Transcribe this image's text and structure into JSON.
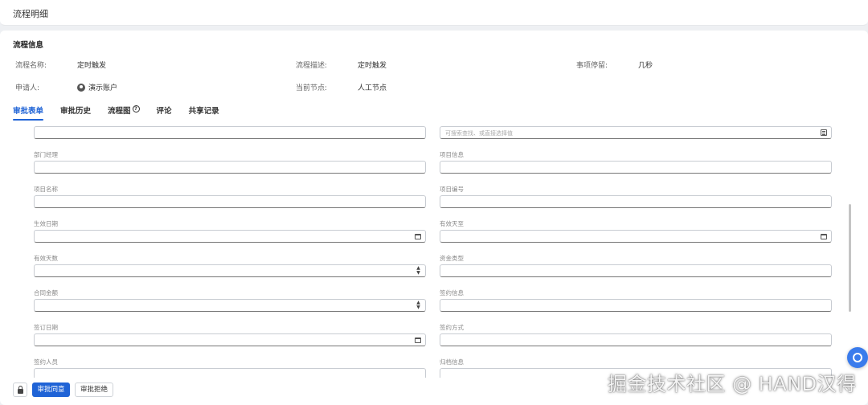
{
  "page": {
    "title": "流程明细"
  },
  "info": {
    "section_title": "流程信息",
    "fields": [
      {
        "label": "流程名称:",
        "value": "定时触发"
      },
      {
        "label": "流程描述:",
        "value": "定时触发"
      },
      {
        "label": "事项停留:",
        "value": "几秒"
      },
      {
        "label": "申请人:",
        "value": "演示账户"
      },
      {
        "label": "当前节点:",
        "value": "人工节点"
      }
    ]
  },
  "tabs": [
    {
      "label": "审批表单",
      "active": true
    },
    {
      "label": "审批历史"
    },
    {
      "label": "流程图"
    },
    {
      "label": "评论"
    },
    {
      "label": "共享记录"
    }
  ],
  "form": {
    "top_right_placeholder": "可搜索查找、或直接选择值",
    "labels": {
      "dept_manager": "部门经理",
      "project_info": "项目信息",
      "project_name": "项目名称",
      "project_code": "项目编号",
      "effective_date": "生效日期",
      "effective_until": "有效天至",
      "effective_days": "有效天数",
      "fund_type": "资金类型",
      "contract_amount": "合同金额",
      "sign_info": "签约信息",
      "sign_date": "签订日期",
      "sign_method": "签约方式",
      "signer": "签约人员",
      "archive_info": "归档信息"
    }
  },
  "footer": {
    "approve_label": "审批同意",
    "reject_label": "审批拒绝"
  },
  "watermark": "掘金技术社区 @ HAND汉得",
  "colors": {
    "primary": "#1f63d6",
    "float_button": "#3a7bec"
  }
}
